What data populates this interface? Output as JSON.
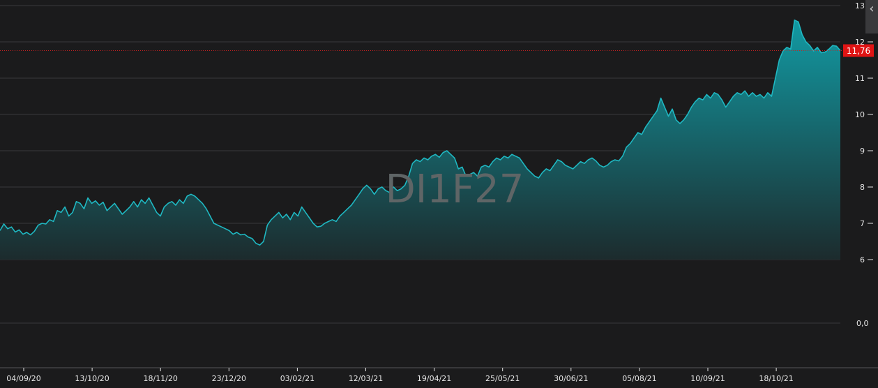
{
  "chart_data": {
    "type": "area",
    "watermark": "DI1F27",
    "last_value_label": "11,76",
    "last_value": 11.76,
    "ylim": [
      6,
      13
    ],
    "y_ticks": [
      {
        "value": 13,
        "label": "13"
      },
      {
        "value": 12,
        "label": "12"
      },
      {
        "value": 11,
        "label": "11"
      },
      {
        "value": 10,
        "label": "10"
      },
      {
        "value": 9,
        "label": "9"
      },
      {
        "value": 8,
        "label": "8"
      },
      {
        "value": 7,
        "label": "7"
      },
      {
        "value": 6,
        "label": "6"
      }
    ],
    "lower_pane_label": "0,0",
    "x_tick_labels": [
      "04/09/20",
      "13/10/20",
      "18/11/20",
      "23/12/20",
      "03/02/21",
      "12/03/21",
      "19/04/21",
      "25/05/21",
      "30/06/21",
      "05/08/21",
      "10/09/21",
      "18/10/21"
    ],
    "series": [
      {
        "values": [
          6.8,
          6.98,
          6.85,
          6.9,
          6.76,
          6.82,
          6.7,
          6.75,
          6.68,
          6.78,
          6.95,
          7.0,
          6.98,
          7.1,
          7.05,
          7.35,
          7.3,
          7.45,
          7.2,
          7.3,
          7.6,
          7.55,
          7.4,
          7.7,
          7.55,
          7.62,
          7.5,
          7.58,
          7.35,
          7.45,
          7.55,
          7.4,
          7.25,
          7.35,
          7.45,
          7.6,
          7.45,
          7.65,
          7.55,
          7.7,
          7.5,
          7.3,
          7.2,
          7.45,
          7.55,
          7.6,
          7.5,
          7.65,
          7.55,
          7.75,
          7.8,
          7.75,
          7.65,
          7.55,
          7.4,
          7.2,
          7.0,
          6.95,
          6.9,
          6.85,
          6.8,
          6.7,
          6.75,
          6.68,
          6.7,
          6.62,
          6.58,
          6.45,
          6.4,
          6.5,
          6.95,
          7.1,
          7.2,
          7.3,
          7.15,
          7.25,
          7.1,
          7.3,
          7.2,
          7.45,
          7.3,
          7.15,
          7.0,
          6.9,
          6.92,
          7.0,
          7.05,
          7.1,
          7.05,
          7.2,
          7.3,
          7.4,
          7.5,
          7.65,
          7.8,
          7.95,
          8.05,
          7.95,
          7.8,
          7.95,
          8.0,
          7.9,
          7.85,
          8.0,
          7.9,
          7.95,
          8.05,
          8.3,
          8.65,
          8.75,
          8.7,
          8.8,
          8.75,
          8.85,
          8.9,
          8.82,
          8.95,
          9.0,
          8.9,
          8.8,
          8.5,
          8.55,
          8.3,
          8.35,
          8.4,
          8.3,
          8.55,
          8.6,
          8.55,
          8.7,
          8.8,
          8.75,
          8.85,
          8.8,
          8.9,
          8.85,
          8.8,
          8.65,
          8.5,
          8.4,
          8.3,
          8.25,
          8.4,
          8.5,
          8.45,
          8.6,
          8.75,
          8.7,
          8.6,
          8.55,
          8.5,
          8.6,
          8.7,
          8.65,
          8.75,
          8.8,
          8.72,
          8.6,
          8.55,
          8.6,
          8.7,
          8.75,
          8.72,
          8.85,
          9.1,
          9.2,
          9.35,
          9.5,
          9.45,
          9.65,
          9.8,
          9.95,
          10.1,
          10.45,
          10.2,
          9.95,
          10.15,
          9.85,
          9.75,
          9.85,
          10.0,
          10.2,
          10.35,
          10.45,
          10.4,
          10.55,
          10.45,
          10.6,
          10.55,
          10.4,
          10.2,
          10.35,
          10.5,
          10.6,
          10.55,
          10.65,
          10.5,
          10.6,
          10.5,
          10.55,
          10.45,
          10.6,
          10.5,
          11.0,
          11.5,
          11.75,
          11.85,
          11.8,
          12.6,
          12.55,
          12.2,
          12.0,
          11.9,
          11.75,
          11.85,
          11.7,
          11.72,
          11.8,
          11.9,
          11.88,
          11.76
        ]
      }
    ],
    "colors": {
      "background": "#1b1b1c",
      "line": "#1fb8c2",
      "fill_top": "#129aa3",
      "fill_bottom": "#1c2b2d",
      "grid": "#3a3a3c",
      "axis_text": "#e6e6e6",
      "price_line": "#cc1f1f",
      "price_badge": "#e01414",
      "watermark": "#5f6566"
    }
  },
  "controls": {
    "collapse_icon_label": "‹"
  }
}
